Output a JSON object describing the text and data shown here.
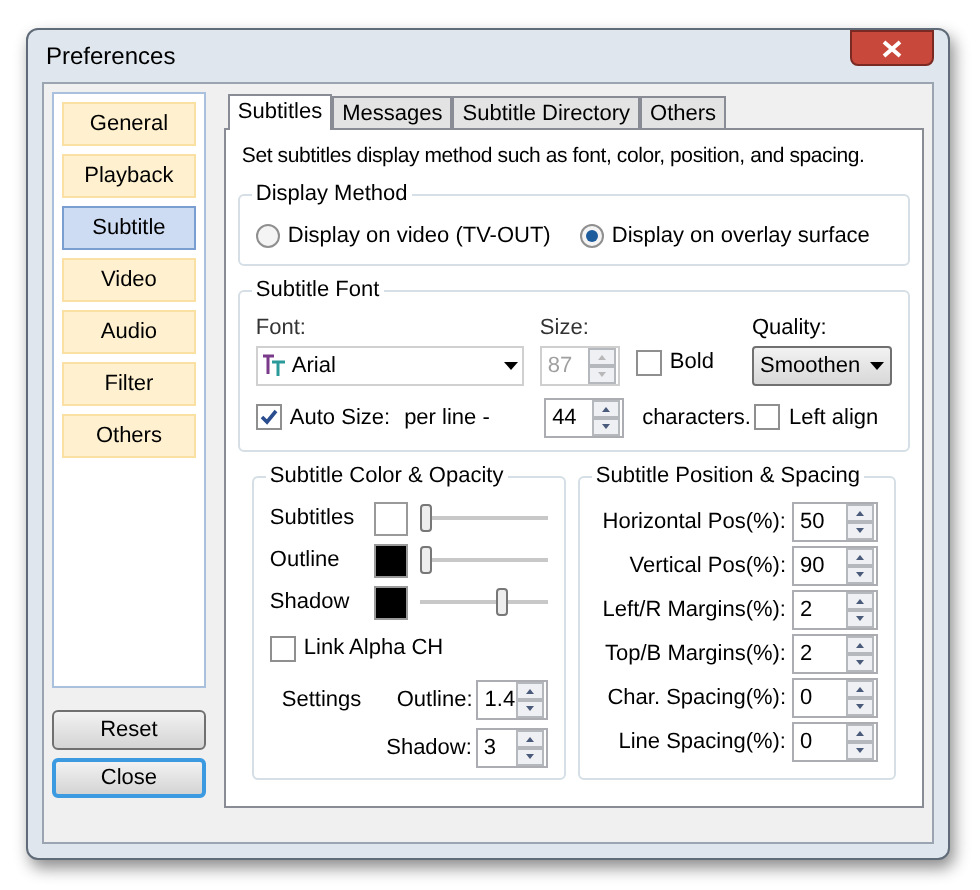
{
  "window": {
    "title": "Preferences"
  },
  "sidebar": {
    "items": [
      {
        "label": "General",
        "selected": false
      },
      {
        "label": "Playback",
        "selected": false
      },
      {
        "label": "Subtitle",
        "selected": true
      },
      {
        "label": "Video",
        "selected": false
      },
      {
        "label": "Audio",
        "selected": false
      },
      {
        "label": "Filter",
        "selected": false
      },
      {
        "label": "Others",
        "selected": false
      }
    ]
  },
  "buttons": [
    {
      "label": "Reset",
      "default": false
    },
    {
      "label": "Close",
      "default": true
    }
  ],
  "tabs": [
    {
      "label": "Subtitles",
      "selected": true
    },
    {
      "label": "Messages",
      "selected": false
    },
    {
      "label": "Subtitle Directory",
      "selected": false
    },
    {
      "label": "Others",
      "selected": false
    }
  ],
  "description": "Set subtitles display method such as font, color, position, and spacing.",
  "display_method": {
    "title": "Display Method",
    "options": [
      {
        "label": "Display on video (TV-OUT)",
        "selected": false
      },
      {
        "label": "Display on overlay surface",
        "selected": true
      }
    ]
  },
  "subtitle_font": {
    "title": "Subtitle Font",
    "font": {
      "label": "Font:",
      "value": "Arial"
    },
    "size": {
      "label": "Size:",
      "value": "87",
      "disabled": true
    },
    "bold": {
      "label": "Bold",
      "checked": false
    },
    "quality": {
      "label": "Quality:",
      "value": "Smoothen"
    },
    "auto_size": {
      "label": "Auto Size:",
      "checked": true
    },
    "per_line": "per line -",
    "chars_per_line": {
      "value": "44",
      "disabled": false
    },
    "characters_label": "characters.",
    "left_align": {
      "label": "Left align",
      "checked": false
    }
  },
  "color_opacity": {
    "title": "Subtitle Color & Opacity",
    "rows": [
      {
        "label": "Subtitles",
        "color": "#ffffff",
        "level": 0.0
      },
      {
        "label": "Outline",
        "color": "#000000",
        "level": 0.0
      },
      {
        "label": "Shadow",
        "color": "#000000",
        "level": 0.65
      }
    ],
    "link_alpha": {
      "label": "Link Alpha CH",
      "checked": false
    },
    "settings_label": "Settings",
    "outline": {
      "label": "Outline:",
      "value": "1.4"
    },
    "shadow": {
      "label": "Shadow:",
      "value": "3"
    }
  },
  "position_spacing": {
    "title": "Subtitle Position & Spacing",
    "fields": [
      {
        "label": "Horizontal Pos(%):",
        "value": "50"
      },
      {
        "label": "Vertical Pos(%):",
        "value": "90"
      },
      {
        "label": "Left/R Margins(%):",
        "value": "2"
      },
      {
        "label": "Top/B Margins(%):",
        "value": "2"
      },
      {
        "label": "Char. Spacing(%):",
        "value": "0"
      },
      {
        "label": "Line Spacing(%):",
        "value": "0"
      }
    ]
  }
}
